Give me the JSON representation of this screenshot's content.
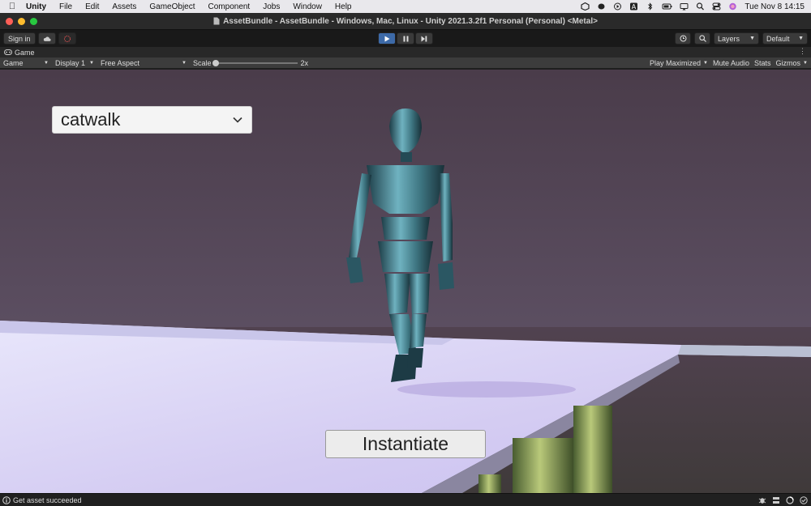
{
  "menubar": {
    "app_name": "Unity",
    "items": [
      "File",
      "Edit",
      "Assets",
      "GameObject",
      "Component",
      "Jobs",
      "Window",
      "Help"
    ],
    "clock": "Tue Nov 8  14:15"
  },
  "window": {
    "title": "AssetBundle - AssetBundle - Windows, Mac, Linux - Unity 2021.3.2f1 Personal (Personal) <Metal>"
  },
  "toolbar": {
    "sign_in": "Sign in",
    "layers": "Layers",
    "layout": "Default"
  },
  "tab": {
    "label": "Game"
  },
  "gamebar": {
    "view": "Game",
    "display": "Display 1",
    "aspect": "Free Aspect",
    "scale_label": "Scale",
    "scale_value": "2x",
    "play_maximized": "Play Maximized",
    "mute_audio": "Mute Audio",
    "stats": "Stats",
    "gizmos": "Gizmos"
  },
  "game_ui": {
    "animation_selected": "catwalk",
    "instantiate_label": "Instantiate"
  },
  "statusbar": {
    "message": "Get asset succeeded"
  },
  "colors": {
    "play_active": "#3d6aa8",
    "backdrop": "#4b3e4c",
    "runway": "#dcd6f4",
    "robot": "#4a7f8c"
  }
}
